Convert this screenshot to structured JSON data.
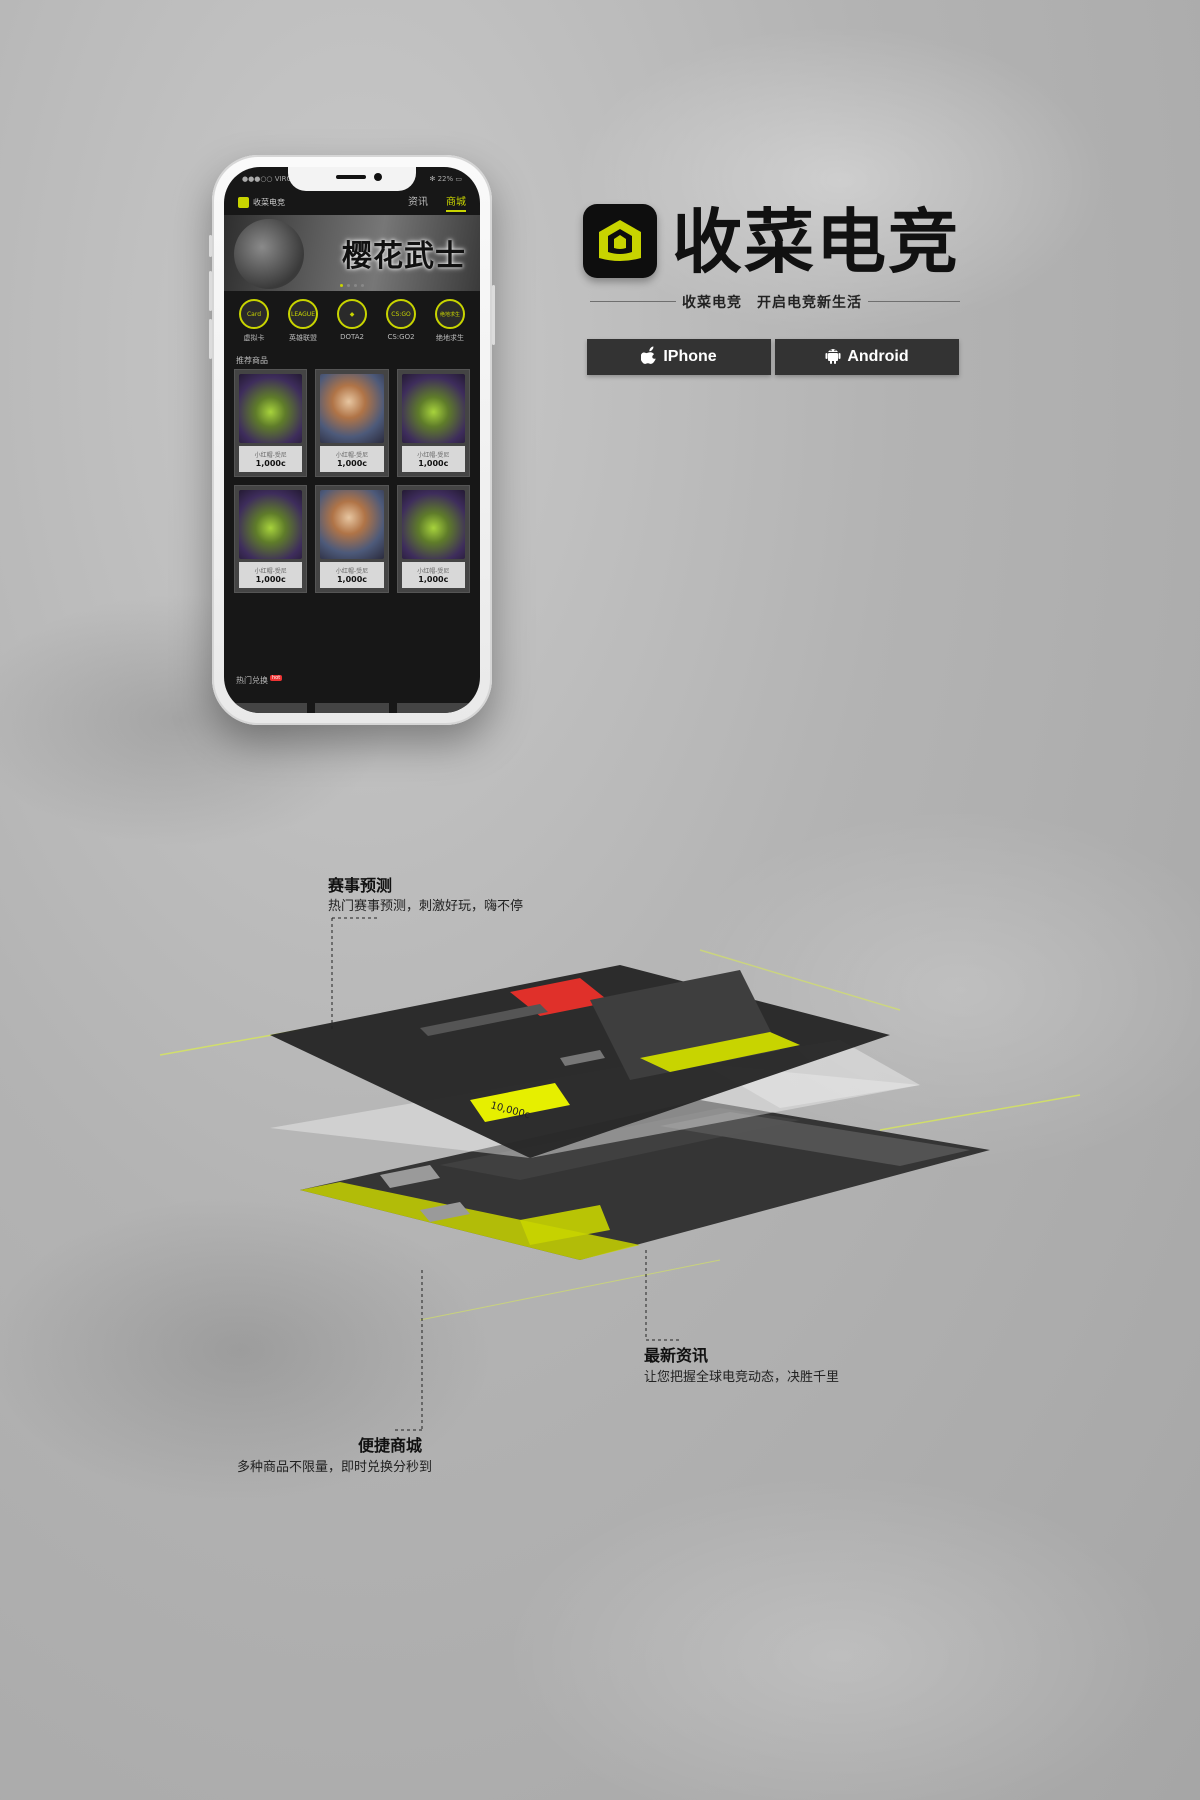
{
  "phone": {
    "status_carrier": "●●●○○ VIRGIN",
    "status_battery": "✻ 22% ▭",
    "app_name": "收菜电竞",
    "tabs": [
      {
        "label": "资讯",
        "active": false
      },
      {
        "label": "商城",
        "active": true
      }
    ],
    "banner_title": "樱花武士",
    "categories": [
      {
        "label": "虚拟卡",
        "icon_text": "Card"
      },
      {
        "label": "英雄联盟",
        "icon_text": "LEAGUE"
      },
      {
        "label": "DOTA2",
        "icon_text": "◆"
      },
      {
        "label": "CS:GO2",
        "icon_text": "CS:GO"
      },
      {
        "label": "绝地求生",
        "icon_text": "绝地求生"
      }
    ],
    "recommended_title": "推荐商品",
    "products": [
      {
        "name": "小红帽-受尼",
        "price": "1,000c",
        "art": "a"
      },
      {
        "name": "小红帽-受尼",
        "price": "1,000c",
        "art": "b"
      },
      {
        "name": "小红帽-受尼",
        "price": "1,000c",
        "art": "a"
      },
      {
        "name": "小红帽-受尼",
        "price": "1,000c",
        "art": "a"
      },
      {
        "name": "小红帽-受尼",
        "price": "1,000c",
        "art": "b"
      },
      {
        "name": "小红帽-受尼",
        "price": "1,000c",
        "art": "a"
      }
    ],
    "hot_title": "热门兑换",
    "hot_badge": "hot"
  },
  "brand": {
    "name": "收菜电竞",
    "slogan": "收菜电竞　开启电竞新生活",
    "iphone_label": "IPhone",
    "android_label": "Android",
    "accent": "#c8d400"
  },
  "features": {
    "prediction": {
      "title": "赛事预测",
      "desc": "热门赛事预测，刺激好玩，嗨不停"
    },
    "news": {
      "title": "最新资讯",
      "desc": "让您把握全球电竞动态，决胜千里"
    },
    "shop": {
      "title": "便捷商城",
      "desc": "多种商品不限量，即时兑换分秒到"
    }
  },
  "layer_texts": {
    "price_tag": "10,000c"
  }
}
